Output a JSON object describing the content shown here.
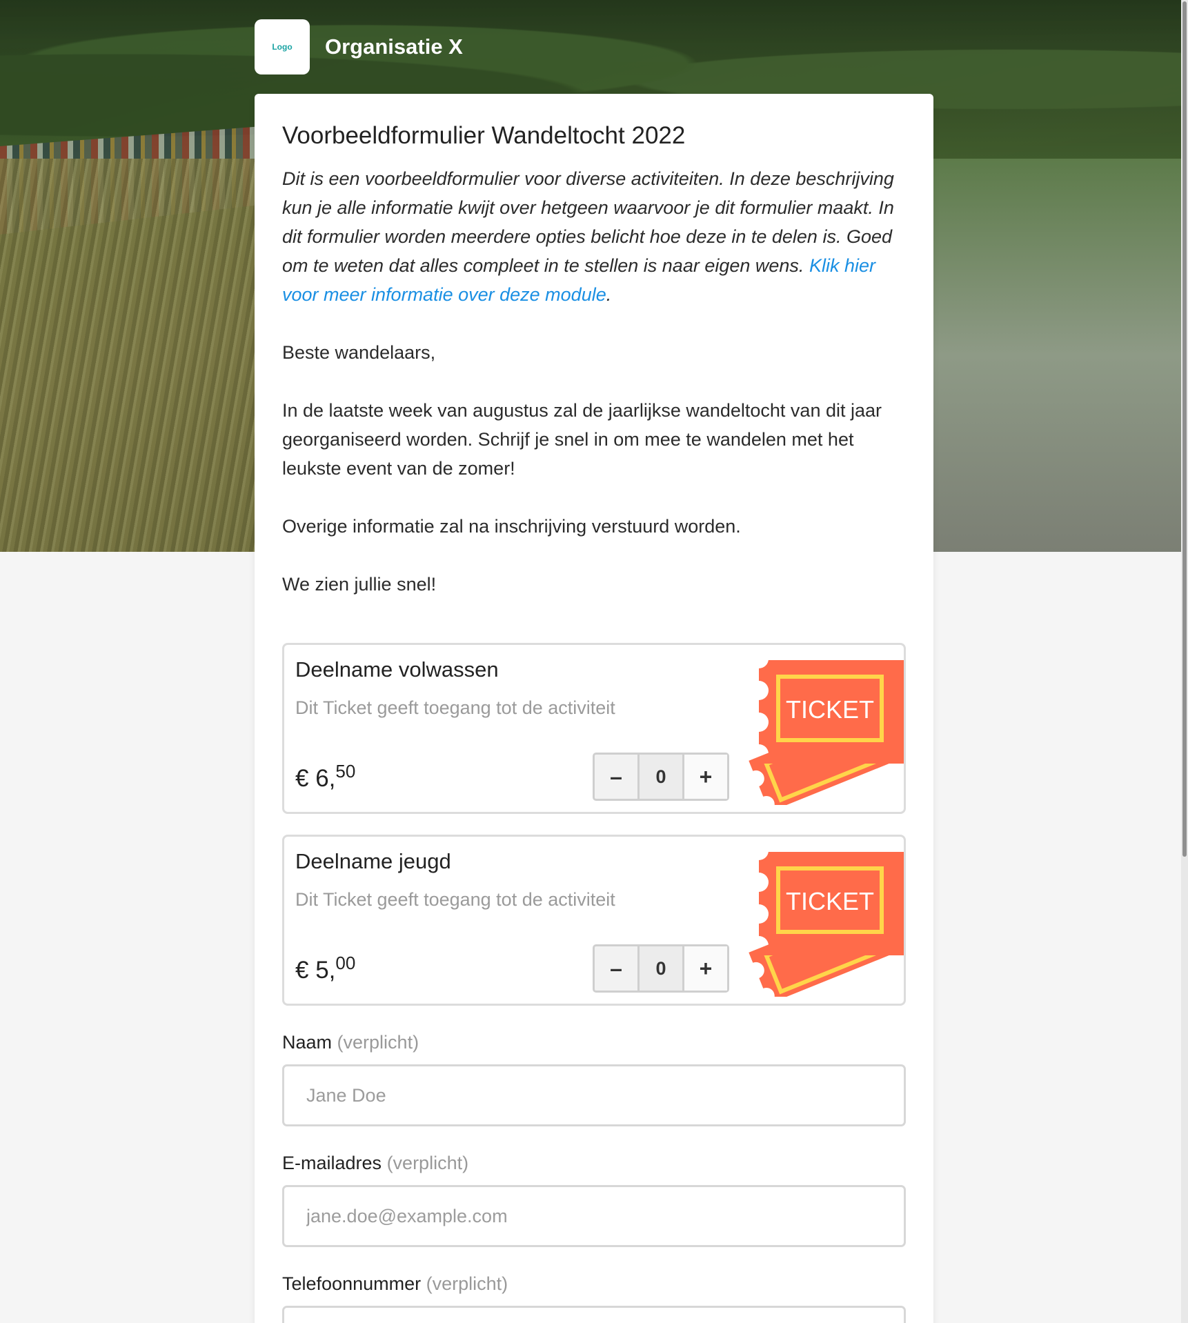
{
  "header": {
    "logo_text": "Logo",
    "org_name": "Organisatie X"
  },
  "form": {
    "title": "Voorbeeldformulier Wandeltocht 2022",
    "intro_text": "Dit is een voorbeeldformulier voor diverse activiteiten. In deze beschrijving kun je alle informatie kwijt over hetgeen waarvoor je dit formulier maakt. In dit formulier worden meerdere opties belicht hoe deze in te delen is. Goed om te weten dat alles compleet in te stellen is naar eigen wens.",
    "intro_link": "Klik hier voor meer informatie over deze module",
    "intro_end": ".",
    "greeting": "Beste wandelaars,",
    "paragraph": "In de laatste week van augustus zal de jaarlijkse wandeltocht van dit jaar georganiseerd worden. Schrijf je snel in om mee te wandelen met het leukste event van de zomer!",
    "info": "Overige informatie zal na inschrijving verstuurd worden.",
    "closing": "We zien jullie snel!"
  },
  "tickets": [
    {
      "name": "Deelname volwassen",
      "description": "Dit Ticket geeft toegang tot de activiteit",
      "price_main": "€ 6,",
      "price_cents": "50",
      "quantity": "0",
      "minus": "–",
      "plus": "+",
      "art_label": "TICKET"
    },
    {
      "name": "Deelname jeugd",
      "description": "Dit Ticket geeft toegang tot de activiteit",
      "price_main": "€ 5,",
      "price_cents": "00",
      "quantity": "0",
      "minus": "–",
      "plus": "+",
      "art_label": "TICKET"
    }
  ],
  "fields": {
    "name": {
      "label": "Naam",
      "required": "(verplicht)",
      "placeholder": "Jane Doe"
    },
    "email": {
      "label": "E-mailadres",
      "required": "(verplicht)",
      "placeholder": "jane.doe@example.com"
    },
    "phone": {
      "label": "Telefoonnummer",
      "required": "(verplicht)",
      "placeholder": ""
    }
  },
  "colors": {
    "link": "#1a8fe3",
    "ticket_art": "#ff6b4a",
    "ticket_art_accent": "#ffd54a"
  }
}
